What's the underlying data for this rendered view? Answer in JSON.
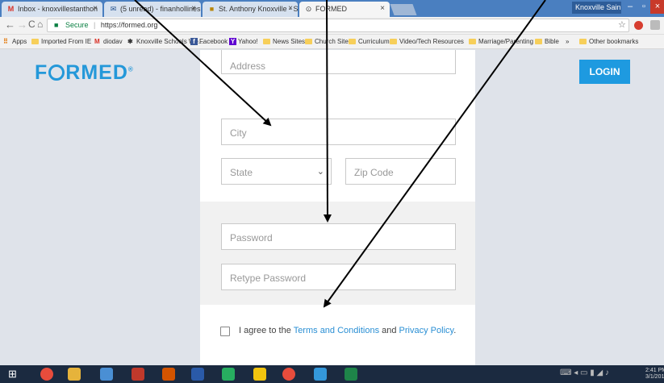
{
  "browser": {
    "tabs": [
      {
        "label": "Inbox - knoxvillestanthon",
        "icon": "gmail-icon"
      },
      {
        "label": "(5 unread) - finanhollines",
        "icon": "mail-icon"
      },
      {
        "label": "St. Anthony Knoxville - S",
        "icon": "church-icon"
      },
      {
        "label": "FORMED",
        "icon": "formed-icon"
      }
    ],
    "profile_label": "Knoxville Sain...",
    "url": "https://formed.org",
    "secure_label": "Secure",
    "bookmarks": [
      {
        "label": "Apps",
        "icon": "apps-grid-icon"
      },
      {
        "label": "Imported From IE",
        "icon": "folder-icon"
      },
      {
        "label": "diodav",
        "icon": "gmail-icon"
      },
      {
        "label": "Knoxville Schools We...",
        "icon": "site-icon"
      },
      {
        "label": "Facebook",
        "icon": "facebook-icon"
      },
      {
        "label": "Yahoo!",
        "icon": "yahoo-icon"
      },
      {
        "label": "News Sites",
        "icon": "folder-icon"
      },
      {
        "label": "Church Sites",
        "icon": "folder-icon"
      },
      {
        "label": "Curriculum",
        "icon": "folder-icon"
      },
      {
        "label": "Video/Tech Resources",
        "icon": "folder-icon"
      },
      {
        "label": "Marriage/Parenting",
        "icon": "folder-icon"
      },
      {
        "label": "Bible",
        "icon": "folder-icon"
      },
      {
        "label": "»",
        "icon": ""
      },
      {
        "label": "Other bookmarks",
        "icon": "folder-icon"
      }
    ]
  },
  "site": {
    "logo_text": "FORMED",
    "login_label": "LOGIN"
  },
  "form": {
    "address_placeholder": "Address",
    "city_placeholder": "City",
    "state_placeholder": "State",
    "zip_placeholder": "Zip Code",
    "password_placeholder": "Password",
    "retype_placeholder": "Retype Password",
    "agree_prefix": "I agree to the ",
    "terms_link": "Terms and Conditions",
    "agree_mid": " and ",
    "privacy_link": "Privacy Policy",
    "agree_suffix": "."
  },
  "taskbar": {
    "clock_time": "2:41 PM",
    "clock_date": "3/1/2018"
  },
  "colors": {
    "brand": "#2498d9",
    "login_button": "#1e9ae0",
    "link": "#2a8fd4",
    "page_bg": "#dfe3ea"
  }
}
